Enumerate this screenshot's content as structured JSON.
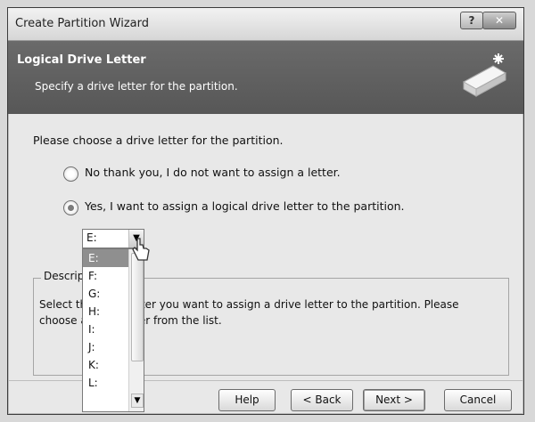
{
  "window": {
    "title": "Create Partition Wizard",
    "help_glyph": "?",
    "close_glyph": "✕"
  },
  "banner": {
    "title": "Logical Drive Letter",
    "subtitle": "Specify a drive letter for the partition."
  },
  "content": {
    "prompt": "Please choose a drive letter for the partition.",
    "options": [
      {
        "label": "No thank you, I do not want to assign a letter.",
        "checked": false
      },
      {
        "label": "Yes, I want to assign a logical drive letter to the partition.",
        "checked": true
      }
    ],
    "dropdown": {
      "value": "E:",
      "options": [
        "E:",
        "F:",
        "G:",
        "H:",
        "I:",
        "J:",
        "K:",
        "L:"
      ],
      "selected_index": 0
    },
    "description": {
      "title": "Description",
      "text": "Select the drive letter you want to assign a drive letter to the partition. Please choose a drive letter from the list."
    }
  },
  "buttons": {
    "help": "Help",
    "back": "< Back",
    "next": "Next >",
    "cancel": "Cancel"
  },
  "icons": {
    "drive": "drive-icon",
    "cursor": "mouse-cursor-icon"
  }
}
